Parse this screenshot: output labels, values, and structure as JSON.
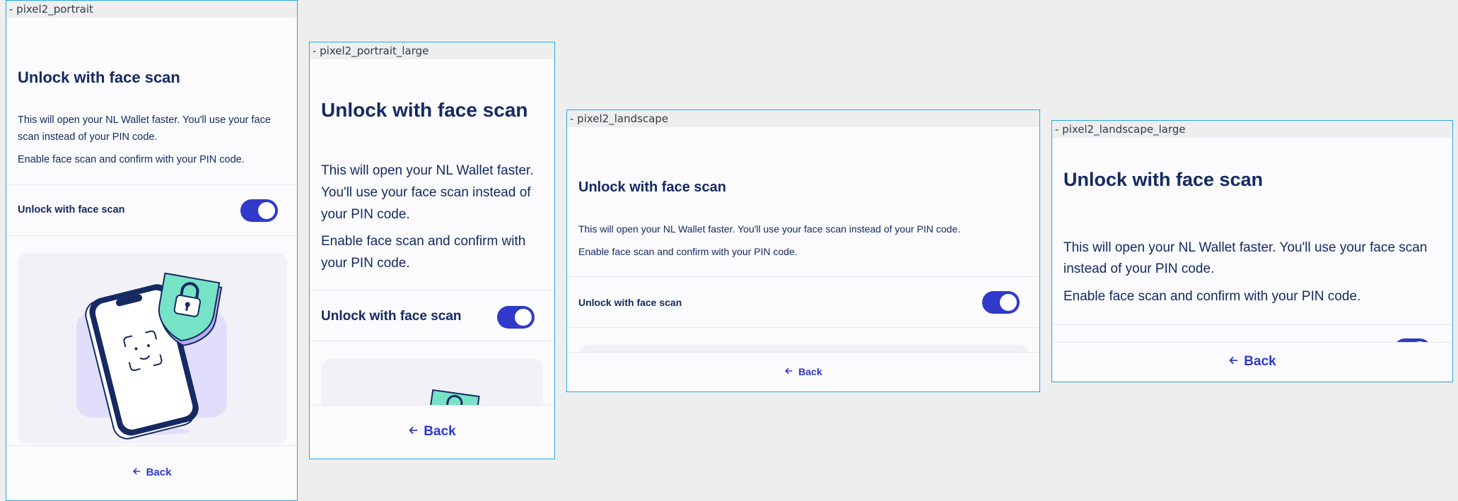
{
  "frames": [
    {
      "label": "- pixel2_portrait"
    },
    {
      "label": "- pixel2_portrait_large"
    },
    {
      "label": "- pixel2_landscape"
    },
    {
      "label": "- pixel2_landscape_large"
    }
  ],
  "screen": {
    "title": "Unlock with face scan",
    "description": "This will open your NL Wallet faster. You'll use your face scan instead of your PIN code.",
    "instruction": "Enable face scan and confirm with your PIN code.",
    "toggle_label": "Unlock with face scan",
    "toggle_on": true,
    "back_label": "Back",
    "back_icon": "arrow-left-icon",
    "illustration_icon": "phone-face-scan-lock-illustration"
  },
  "colors": {
    "primary": "#3039c9",
    "text": "#152a62",
    "background": "#fbfbfd",
    "frame_border": "#29a8e0",
    "shield": "#76e3c7"
  }
}
